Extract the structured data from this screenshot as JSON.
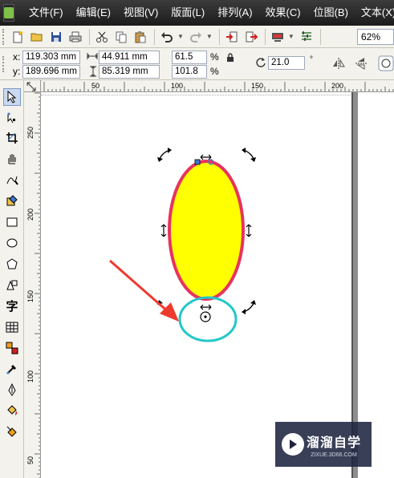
{
  "menu": {
    "items": [
      "文件(F)",
      "编辑(E)",
      "视图(V)",
      "版面(L)",
      "排列(A)",
      "效果(C)",
      "位图(B)",
      "文本(X)"
    ]
  },
  "toolbar": {
    "buttons": [
      "new-icon",
      "open-icon",
      "save-icon",
      "print-icon",
      "cut-icon",
      "copy-icon",
      "paste-icon",
      "undo-icon",
      "redo-icon",
      "import-icon",
      "export-icon",
      "application-launcher-icon",
      "options-icon"
    ],
    "zoom": "62%"
  },
  "propbar": {
    "x_label": "x:",
    "x_value": "119.303 mm",
    "y_label": "y:",
    "y_value": "189.696 mm",
    "width_value": "44.911 mm",
    "height_value": "85.319 mm",
    "scale_x": "61.5",
    "scale_y": "101.8",
    "percent_symbol_x": "%",
    "percent_symbol_y": "%",
    "rotation_value": "21.0",
    "degree_symbol": "°"
  },
  "toolbox": {
    "tools": [
      "pick-tool-icon",
      "shape-tool-icon",
      "crop-tool-icon",
      "pan-tool-icon",
      "freehand-tool-icon",
      "smart-fill-tool-icon",
      "rectangle-tool-icon",
      "ellipse-tool-icon",
      "polygon-tool-icon",
      "basic-shapes-tool-icon",
      "text-tool-icon",
      "table-tool-icon",
      "interactive-blend-tool-icon",
      "eyedropper-tool-icon",
      "outline-tool-icon",
      "fill-tool-icon",
      "interactive-fill-tool-icon"
    ],
    "text_tool_glyph": "字"
  },
  "rulers": {
    "horizontal_labels": [
      "50",
      "100",
      "150",
      "200"
    ],
    "vertical_labels": [
      "250",
      "200",
      "150",
      "100",
      "50"
    ]
  },
  "shapes": {
    "ellipse_fill": "#ffff00",
    "ellipse_outline": "#e8335e",
    "rotation_circle_color": "#23c7c9",
    "arrow_color": "#ee3a2e"
  },
  "watermark": {
    "title": "溜溜自学",
    "subtitle": "ZIXUE.3D66.COM"
  }
}
